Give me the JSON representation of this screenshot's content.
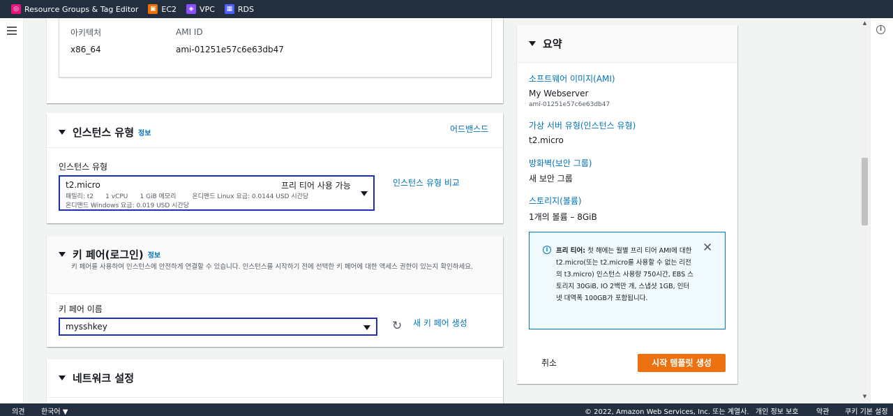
{
  "favorites": [
    {
      "label": "Resource Groups & Tag Editor",
      "icon": "resource-groups-icon",
      "color": "#e7157b"
    },
    {
      "label": "EC2",
      "icon": "ec2-icon",
      "color": "#ed7100"
    },
    {
      "label": "VPC",
      "icon": "vpc-icon",
      "color": "#8c4fff"
    },
    {
      "label": "RDS",
      "icon": "rds-icon",
      "color": "#4d5fff"
    }
  ],
  "ami": {
    "arch_label": "아키텍처",
    "arch_value": "x86_64",
    "id_label": "AMI ID",
    "id_value": "ami-01251e57c6e63db47"
  },
  "instance_type": {
    "title": "인스턴스 유형",
    "info": "정보",
    "advanced": "어드밴스드",
    "field_label": "인스턴스 유형",
    "selected": "t2.micro",
    "free_tier": "프리 티어 사용 가능",
    "line1": "패밀리: t2      1 vCPU      1 GiB 메모리        온디맨드 Linux 요금: 0.0144 USD 시간당",
    "line2": "온디맨드 Windows 요금: 0.019 USD 시간당",
    "compare": "인스턴스 유형 비교"
  },
  "key_pair": {
    "title": "키 페어(로그인)",
    "info": "정보",
    "desc": "키 페어를 사용하여 인스턴스에 안전하게 연결할 수 있습니다. 인스턴스를 시작하기 전에 선택한 키 페어에 대한 액세스 권한이 있는지 확인하세요.",
    "field_label": "키 페어 이름",
    "selected": "mysshkey",
    "create": "새 키 페어 생성"
  },
  "network": {
    "title": "네트워크 설정"
  },
  "summary": {
    "title": "요약",
    "ami_label": "소프트웨어 이미지(AMI)",
    "ami_name": "My Webserver",
    "ami_id": "ami-01251e57c6e63db47",
    "type_label": "가상 서버 유형(인스턴스 유형)",
    "type_value": "t2.micro",
    "fw_label": "방화벽(보안 그룹)",
    "fw_value": "새 보안 그룹",
    "storage_label": "스토리지(볼륨)",
    "storage_value": "1개의 볼륨 – 8GiB",
    "free_bold": "프리 티어:",
    "free_text": "첫 해에는 월별 프리 티어 AMI에 대한 t2.micro(또는 t2.micro를 사용할 수 없는 리전의 t3.micro) 인스턴스 사용량 750시간, EBS 스토리지 30GiB, IO 2백만 개, 스냅샷 1GB, 인터넷 대역폭 100GB가 포함됩니다.",
    "cancel": "취소",
    "launch": "시작 템플릿 생성"
  },
  "footer": {
    "feedback": "의견",
    "language": "한국어 ▼",
    "copyright": "© 2022, Amazon Web Services, Inc. 또는 계열사.",
    "privacy": "개인 정보 보호",
    "terms": "약관",
    "cookies": "쿠키 기본 설정"
  }
}
